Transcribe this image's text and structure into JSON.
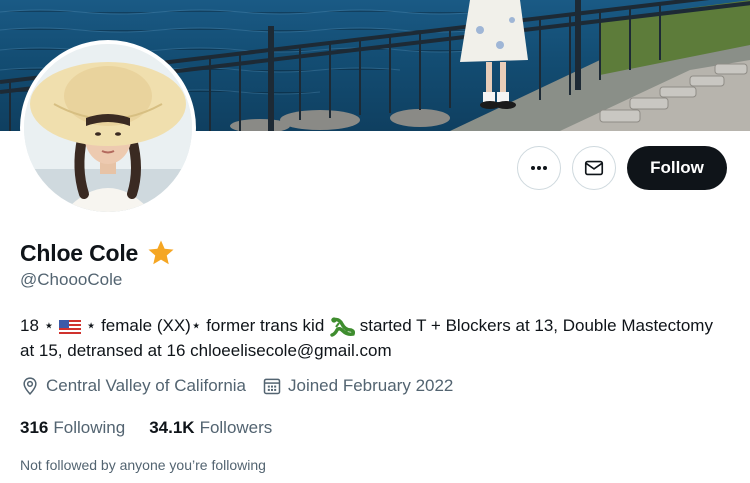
{
  "profile": {
    "name": "Chloe Cole",
    "handle": "@ChoooCole",
    "bio": {
      "seg1": "18 ⋆ ",
      "seg2": " ⋆ female (XX)⋆ former trans kid ",
      "seg3": " started T + Blockers at 13, Double Mastectomy at 15, detransed at 16 chloeelisecole@gmail.com"
    },
    "location": "Central Valley of California",
    "joined": "Joined February 2022",
    "following_count": "316",
    "following_label": "Following",
    "followers_count": "34.1K",
    "followers_label": "Followers",
    "not_followed_text": "Not followed by anyone you’re following"
  },
  "actions": {
    "follow_label": "Follow",
    "more_icon": "more-icon",
    "message_icon": "envelope-icon"
  },
  "icons": {
    "verified": "star-icon",
    "flag": "us-flag-icon",
    "lizard": "lizard-icon",
    "location": "location-pin-icon",
    "calendar": "calendar-icon"
  },
  "colors": {
    "star": "#f5a623",
    "follow_bg": "#0f1419",
    "secondary_text": "#536471"
  }
}
